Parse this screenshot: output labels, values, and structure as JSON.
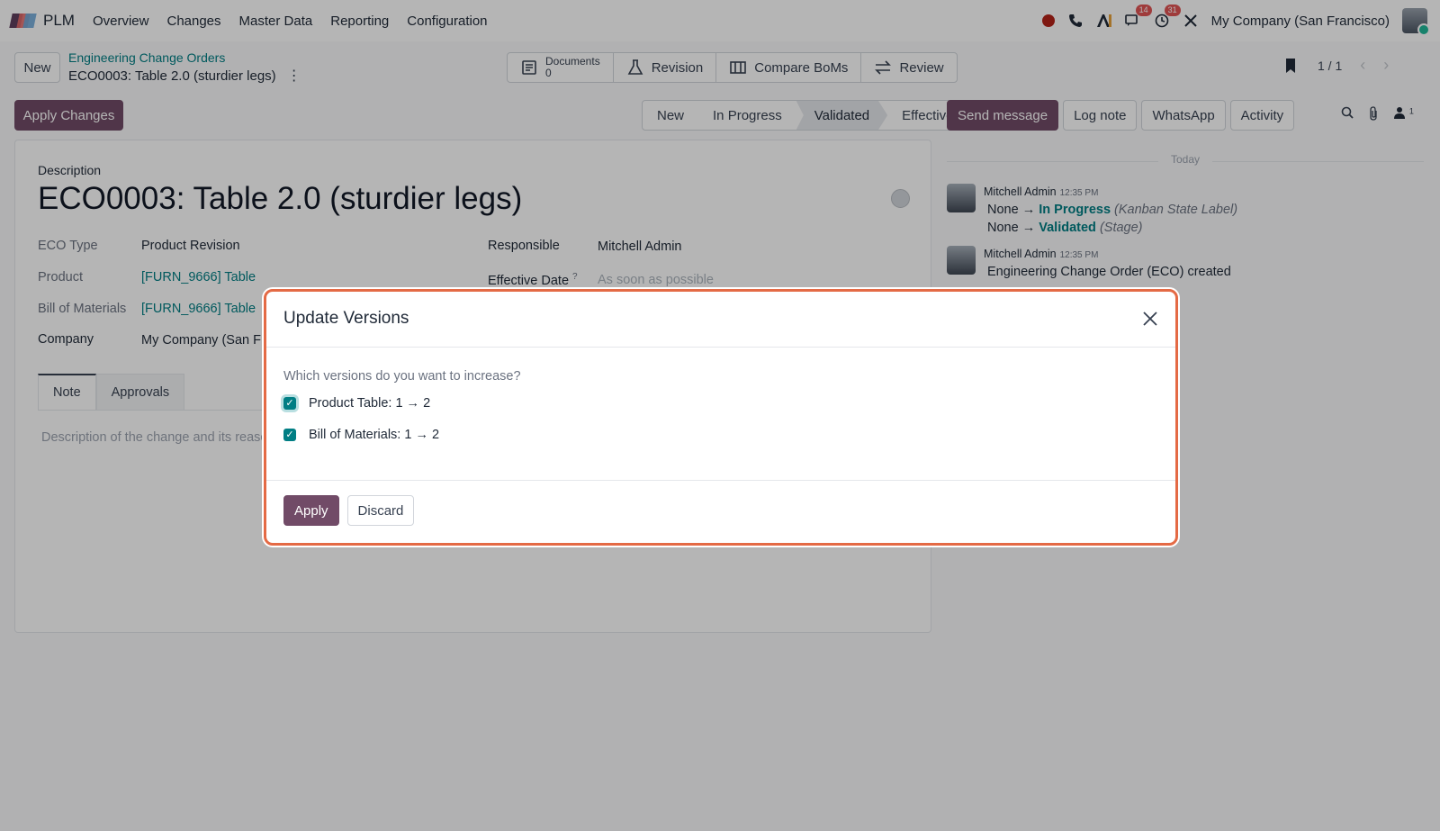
{
  "navbar": {
    "app_name": "PLM",
    "menu": [
      "Overview",
      "Changes",
      "Master Data",
      "Reporting",
      "Configuration"
    ],
    "messages_count": "14",
    "activities_count": "31",
    "company": "My Company (San Francisco)"
  },
  "control": {
    "new_label": "New",
    "breadcrumb_parent": "Engineering Change Orders",
    "breadcrumb_current": "ECO0003: Table 2.0 (sturdier legs)",
    "smart_buttons": {
      "documents_label": "Documents",
      "documents_count": "0",
      "revision": "Revision",
      "compare_boms": "Compare BoMs",
      "review": "Review"
    },
    "pager": "1 / 1",
    "apply_changes": "Apply Changes",
    "stages": [
      "New",
      "In Progress",
      "Validated",
      "Effective"
    ],
    "active_stage": "Validated"
  },
  "chatter": {
    "send_message": "Send message",
    "log_note": "Log note",
    "whatsapp": "WhatsApp",
    "activity": "Activity",
    "followers_count": "1",
    "today": "Today",
    "messages": [
      {
        "author": "Mitchell Admin",
        "time": "12:35 PM",
        "line1_from": "None",
        "line1_to": "In Progress",
        "line1_field": "(Kanban State Label)",
        "line2_from": "None",
        "line2_to": "Validated",
        "line2_field": "(Stage)"
      },
      {
        "author": "Mitchell Admin",
        "time": "12:35 PM",
        "text": "Engineering Change Order (ECO) created"
      }
    ],
    "arrow": "→"
  },
  "form": {
    "description_label": "Description",
    "title": "ECO0003: Table 2.0 (sturdier legs)",
    "eco_type_label": "ECO Type",
    "eco_type_value": "Product Revision",
    "product_label": "Product",
    "product_value": "[FURN_9666] Table",
    "bom_label": "Bill of Materials",
    "bom_value": "[FURN_9666] Table",
    "company_label": "Company",
    "company_value": "My Company (San Fr",
    "responsible_label": "Responsible",
    "responsible_value": "Mitchell Admin",
    "effective_date_label": "Effective Date",
    "effective_date_help": "?",
    "effective_date_placeholder": "As soon as possible",
    "tabs": [
      "Note",
      "Approvals"
    ],
    "note_placeholder": "Description of the change and its reaso"
  },
  "modal": {
    "title": "Update Versions",
    "question": "Which versions do you want to increase?",
    "options": [
      {
        "label": "Product Table: 1 → 2",
        "checked": true
      },
      {
        "label": "Bill of Materials: 1 → 2",
        "checked": true
      }
    ],
    "apply": "Apply",
    "discard": "Discard"
  },
  "colors": {
    "brand": "#714b67",
    "link": "#017e84",
    "modal_highlight": "#e46a45"
  }
}
